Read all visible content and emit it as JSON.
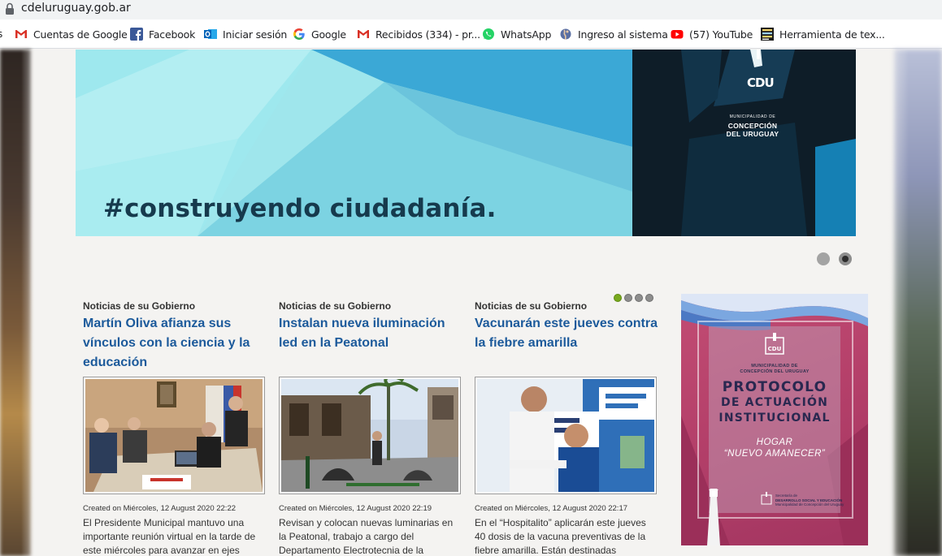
{
  "browser": {
    "url": "cdeluruguay.gob.ar",
    "bookmarks": [
      {
        "icon": "gmail-icon",
        "label": "Cuentas de Google"
      },
      {
        "icon": "facebook-icon",
        "label": "Facebook"
      },
      {
        "icon": "outlook-icon",
        "label": "Iniciar sesión"
      },
      {
        "icon": "google-icon",
        "label": "Google"
      },
      {
        "icon": "gmail-icon",
        "label": "Recibidos (334) - pr..."
      },
      {
        "icon": "whatsapp-icon",
        "label": "WhatsApp"
      },
      {
        "icon": "globe-icon",
        "label": "Ingreso al sistema"
      },
      {
        "icon": "youtube-icon",
        "label": "(57) YouTube"
      },
      {
        "icon": "text-tool-icon",
        "label": "Herramienta de tex..."
      }
    ]
  },
  "hero": {
    "hashtag": "#construyendo ciudadanía.",
    "logo_text": "CDU",
    "org_small": "MUNICIPALIDAD DE",
    "org_line1": "CONCEPCIÓN",
    "org_line2": "DEL URUGUAY"
  },
  "news": [
    {
      "category": "Noticias de su Gobierno",
      "title": "Martín Oliva afianza sus vínculos con la ciencia y la educación",
      "meta": "Created on Miércoles, 12 August 2020 22:22",
      "body": "El Presidente Municipal mantuvo una importante reunión virtual en la tarde de este miércoles para avanzar en ejes"
    },
    {
      "category": "Noticias de su Gobierno",
      "title": "Instalan nueva iluminación led en la Peatonal",
      "meta": "Created on Miércoles, 12 August 2020 22:19",
      "body": "Revisan y colocan nuevas luminarias en la Peatonal, trabajo a cargo del Departamento Electrotecnia de la"
    },
    {
      "category": "Noticias de su Gobierno",
      "title": "Vacunarán este jueves contra la fiebre amarilla",
      "meta": "Created on Miércoles, 12 August 2020 22:17",
      "body": "En el “Hospitalito” aplicarán este jueves 40 dosis de la vacuna preventivas de la fiebre amarilla. Están destinadas"
    }
  ],
  "ad": {
    "muni_line1": "MUNICIPALIDAD DE",
    "muni_line2": "CONCEPCIÓN DEL URUGUAY",
    "protocol_line1": "PROTOCOLO",
    "protocol_line2": "DE ACTUACIÓN",
    "protocol_line3": "INSTITUCIONAL",
    "sub_line1": "HOGAR",
    "sub_line2": "“NUEVO AMANECER”",
    "foot_line1": "Secretaría de",
    "foot_line2": "DESARROLLO SOCIAL Y EDUCACIÓN",
    "foot_line3": "Municipalidad de Concepción del Uruguay"
  },
  "colors": {
    "title_blue": "#1c5a9b",
    "active_dot_green": "#78a91e",
    "ad_pink": "#b5406a"
  }
}
